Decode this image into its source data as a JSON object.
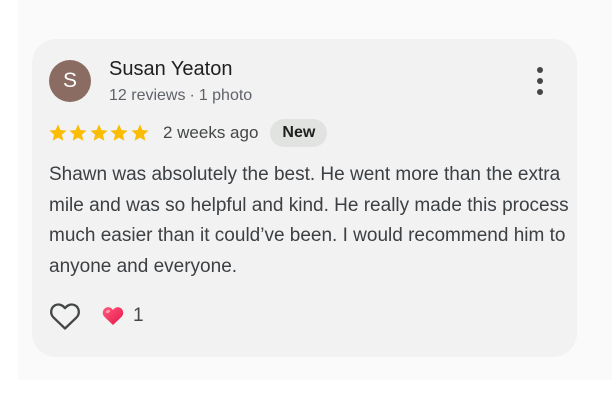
{
  "review": {
    "author": {
      "initial": "S",
      "name": "Susan Yeaton",
      "avatar_color": "#8a6c62"
    },
    "stats": {
      "reviews": "12 reviews",
      "separator": "·",
      "photos": "1 photo"
    },
    "rating": {
      "stars": 5,
      "max": 5,
      "star_color": "#fbbc04",
      "star_icon": "star-icon"
    },
    "time_ago": "2 weeks ago",
    "badge": "New",
    "text": "Shawn was absolutely the best. He went more than the extra mile and was so helpful and kind. He really made this process much easier than it could’ve been. I would recommend him to anyone and everyone.",
    "actions": {
      "like_icon": "heart-outline-icon",
      "reaction_icon": "heart-emoji-icon",
      "reaction_count": "1"
    },
    "menu_icon": "more-vert-icon"
  }
}
